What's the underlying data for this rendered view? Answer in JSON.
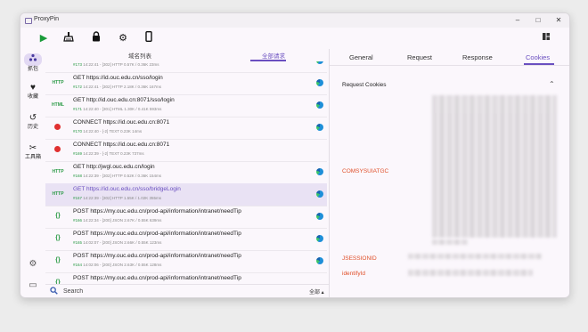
{
  "window": {
    "title": "ProxyPin",
    "min": "–",
    "max": "□",
    "close": "✕"
  },
  "toolbar": {
    "start": "▶",
    "clean": "⚑",
    "lock": "🔒",
    "settings": "⚙",
    "mobile": "▯",
    "layout": "▦"
  },
  "rail": {
    "items": [
      {
        "icon": "⋯",
        "label": "抓包"
      },
      {
        "icon": "♥",
        "label": "收藏"
      },
      {
        "icon": "↺",
        "label": "历史"
      },
      {
        "icon": "✂",
        "label": "工具箱"
      }
    ],
    "settings_icon": "⚙",
    "feedback_icon": "▭"
  },
  "left_tabs": {
    "domain_list": "域名列表",
    "all_requests": "全部请求"
  },
  "requests": [
    {
      "type": "http",
      "title": "",
      "id": "#173",
      "meta": "14:22:41 - [302] HTTP 0.57K / 0.36K 23ms"
    },
    {
      "type": "http",
      "title": "GET https://id.ouc.edu.cn/sso/login",
      "id": "#172",
      "meta": "14:22:41 - [302] HTTP 2.18K / 0.36K 167ms"
    },
    {
      "type": "http",
      "title": "GET http://id.ouc.edu.cn:8071/sso/login",
      "id": "#171",
      "meta": "14:22:40 - [301] HTML 1.30K / 0.41K 593ms"
    },
    {
      "type": "connect",
      "title": "CONNECT https://id.ouc.edu.cn:8071",
      "id": "#170",
      "meta": "14:22:40 - [-2] TEXT 0.23K 14ms"
    },
    {
      "type": "connect",
      "title": "CONNECT https://id.ouc.edu.cn:8071",
      "id": "#169",
      "meta": "14:22:39 - [-2] TEXT 0.23K 737ms"
    },
    {
      "type": "http",
      "title": "GET http://jwgl.ouc.edu.cn/login",
      "id": "#168",
      "meta": "14:22:39 - [302] HTTP 0.52K / 0.36K 154ms"
    },
    {
      "type": "http",
      "title": "GET https://id.ouc.edu.cn/sso/bridgeLogin",
      "id": "#167",
      "meta": "14:22:39 - [302] HTTP 1.55K / 1.02K 355ms",
      "selected": true
    },
    {
      "type": "json",
      "title": "POST https://my.ouc.edu.cn/prod-api/information/intranet/needTip",
      "id": "#166",
      "meta": "14:22:34 - [200] JSON 2.67K / 0.55K 639ms"
    },
    {
      "type": "json",
      "title": "POST https://my.ouc.edu.cn/prod-api/information/intranet/needTip",
      "id": "#165",
      "meta": "14:02:07 - [200] JSON 2.66K / 0.55K 123ms"
    },
    {
      "type": "json",
      "title": "POST https://my.ouc.edu.cn/prod-api/information/intranet/needTip",
      "id": "#164",
      "meta": "14:02:06 - [200] JSON 2.63K / 0.55K 128ms"
    },
    {
      "type": "json",
      "title": "POST https://my.ouc.edu.cn/prod-api/information/intranet/needTip",
      "id": "",
      "meta": ""
    }
  ],
  "search": {
    "placeholder": "Search",
    "filter": "全部 ▴"
  },
  "detail": {
    "tabs": [
      "General",
      "Request",
      "Response",
      "Cookies"
    ],
    "active_tab": "Cookies",
    "section_title": "Request Cookies",
    "cookies": [
      "COMSYSUIATGC",
      "JSESSIONID",
      "identifyId"
    ]
  },
  "colors": {
    "accent": "#6a4fc0",
    "cookie_name": "#e0502a",
    "method_ok": "#2a9a45",
    "connect": "#e03030"
  }
}
